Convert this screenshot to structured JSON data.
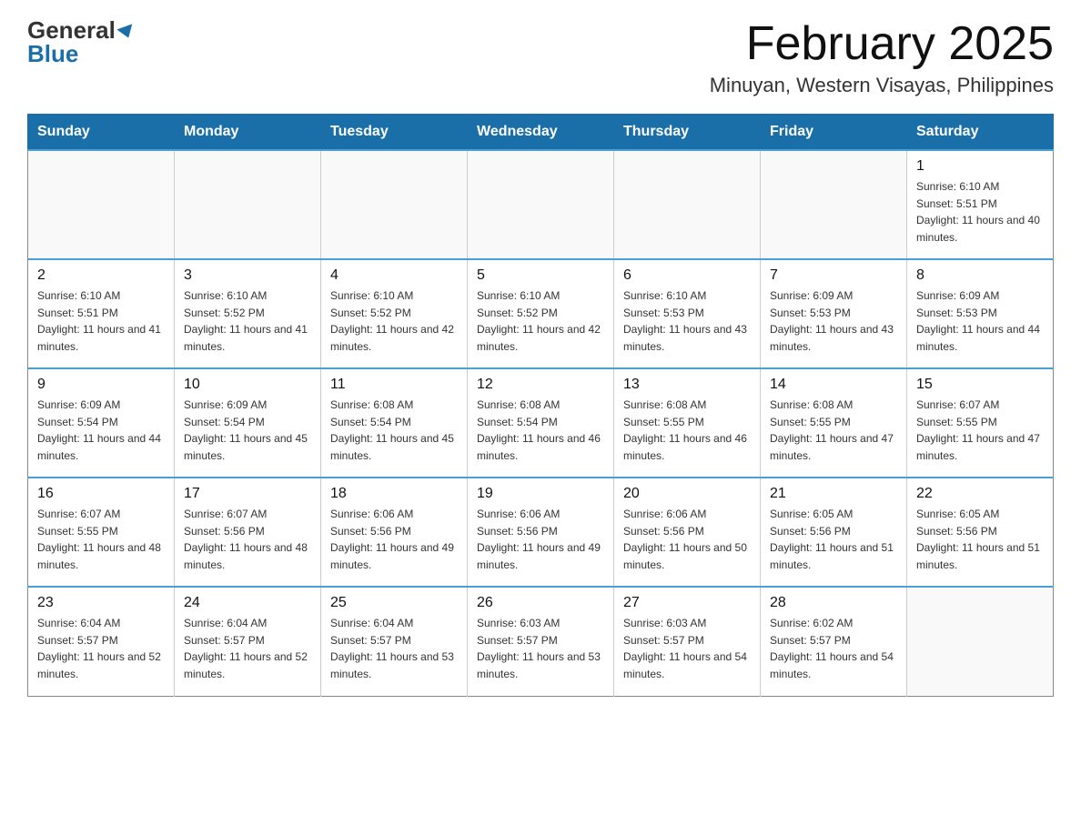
{
  "logo": {
    "general": "General",
    "blue": "Blue"
  },
  "header": {
    "month_year": "February 2025",
    "location": "Minuyan, Western Visayas, Philippines"
  },
  "weekdays": [
    "Sunday",
    "Monday",
    "Tuesday",
    "Wednesday",
    "Thursday",
    "Friday",
    "Saturday"
  ],
  "weeks": [
    [
      {
        "day": "",
        "info": ""
      },
      {
        "day": "",
        "info": ""
      },
      {
        "day": "",
        "info": ""
      },
      {
        "day": "",
        "info": ""
      },
      {
        "day": "",
        "info": ""
      },
      {
        "day": "",
        "info": ""
      },
      {
        "day": "1",
        "info": "Sunrise: 6:10 AM\nSunset: 5:51 PM\nDaylight: 11 hours and 40 minutes."
      }
    ],
    [
      {
        "day": "2",
        "info": "Sunrise: 6:10 AM\nSunset: 5:51 PM\nDaylight: 11 hours and 41 minutes."
      },
      {
        "day": "3",
        "info": "Sunrise: 6:10 AM\nSunset: 5:52 PM\nDaylight: 11 hours and 41 minutes."
      },
      {
        "day": "4",
        "info": "Sunrise: 6:10 AM\nSunset: 5:52 PM\nDaylight: 11 hours and 42 minutes."
      },
      {
        "day": "5",
        "info": "Sunrise: 6:10 AM\nSunset: 5:52 PM\nDaylight: 11 hours and 42 minutes."
      },
      {
        "day": "6",
        "info": "Sunrise: 6:10 AM\nSunset: 5:53 PM\nDaylight: 11 hours and 43 minutes."
      },
      {
        "day": "7",
        "info": "Sunrise: 6:09 AM\nSunset: 5:53 PM\nDaylight: 11 hours and 43 minutes."
      },
      {
        "day": "8",
        "info": "Sunrise: 6:09 AM\nSunset: 5:53 PM\nDaylight: 11 hours and 44 minutes."
      }
    ],
    [
      {
        "day": "9",
        "info": "Sunrise: 6:09 AM\nSunset: 5:54 PM\nDaylight: 11 hours and 44 minutes."
      },
      {
        "day": "10",
        "info": "Sunrise: 6:09 AM\nSunset: 5:54 PM\nDaylight: 11 hours and 45 minutes."
      },
      {
        "day": "11",
        "info": "Sunrise: 6:08 AM\nSunset: 5:54 PM\nDaylight: 11 hours and 45 minutes."
      },
      {
        "day": "12",
        "info": "Sunrise: 6:08 AM\nSunset: 5:54 PM\nDaylight: 11 hours and 46 minutes."
      },
      {
        "day": "13",
        "info": "Sunrise: 6:08 AM\nSunset: 5:55 PM\nDaylight: 11 hours and 46 minutes."
      },
      {
        "day": "14",
        "info": "Sunrise: 6:08 AM\nSunset: 5:55 PM\nDaylight: 11 hours and 47 minutes."
      },
      {
        "day": "15",
        "info": "Sunrise: 6:07 AM\nSunset: 5:55 PM\nDaylight: 11 hours and 47 minutes."
      }
    ],
    [
      {
        "day": "16",
        "info": "Sunrise: 6:07 AM\nSunset: 5:55 PM\nDaylight: 11 hours and 48 minutes."
      },
      {
        "day": "17",
        "info": "Sunrise: 6:07 AM\nSunset: 5:56 PM\nDaylight: 11 hours and 48 minutes."
      },
      {
        "day": "18",
        "info": "Sunrise: 6:06 AM\nSunset: 5:56 PM\nDaylight: 11 hours and 49 minutes."
      },
      {
        "day": "19",
        "info": "Sunrise: 6:06 AM\nSunset: 5:56 PM\nDaylight: 11 hours and 49 minutes."
      },
      {
        "day": "20",
        "info": "Sunrise: 6:06 AM\nSunset: 5:56 PM\nDaylight: 11 hours and 50 minutes."
      },
      {
        "day": "21",
        "info": "Sunrise: 6:05 AM\nSunset: 5:56 PM\nDaylight: 11 hours and 51 minutes."
      },
      {
        "day": "22",
        "info": "Sunrise: 6:05 AM\nSunset: 5:56 PM\nDaylight: 11 hours and 51 minutes."
      }
    ],
    [
      {
        "day": "23",
        "info": "Sunrise: 6:04 AM\nSunset: 5:57 PM\nDaylight: 11 hours and 52 minutes."
      },
      {
        "day": "24",
        "info": "Sunrise: 6:04 AM\nSunset: 5:57 PM\nDaylight: 11 hours and 52 minutes."
      },
      {
        "day": "25",
        "info": "Sunrise: 6:04 AM\nSunset: 5:57 PM\nDaylight: 11 hours and 53 minutes."
      },
      {
        "day": "26",
        "info": "Sunrise: 6:03 AM\nSunset: 5:57 PM\nDaylight: 11 hours and 53 minutes."
      },
      {
        "day": "27",
        "info": "Sunrise: 6:03 AM\nSunset: 5:57 PM\nDaylight: 11 hours and 54 minutes."
      },
      {
        "day": "28",
        "info": "Sunrise: 6:02 AM\nSunset: 5:57 PM\nDaylight: 11 hours and 54 minutes."
      },
      {
        "day": "",
        "info": ""
      }
    ]
  ]
}
